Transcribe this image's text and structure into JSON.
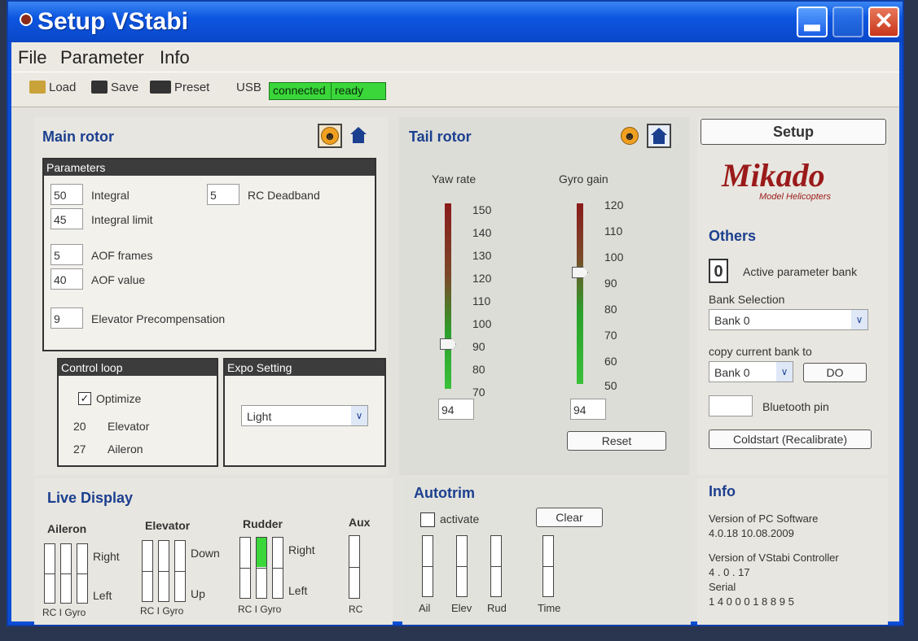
{
  "window": {
    "title": "Setup VStabi",
    "min_label": "▂",
    "close_label": "✕"
  },
  "menu": [
    "File",
    "Parameter",
    "Info"
  ],
  "toolbar": {
    "load": "Load",
    "save": "Save",
    "preset": "Preset",
    "usb": "USB",
    "status1": "connected",
    "status2": "ready"
  },
  "main_rotor": {
    "title": "Main rotor",
    "params_title": "Parameters",
    "integral": {
      "value": "50",
      "label": "Integral"
    },
    "integral_limit": {
      "value": "45",
      "label": "Integral limit"
    },
    "rc_deadband": {
      "value": "5",
      "label": "RC Deadband"
    },
    "aof_frames": {
      "value": "5",
      "label": "AOF frames"
    },
    "aof_value": {
      "value": "40",
      "label": "AOF value"
    },
    "elev_precomp": {
      "value": "9",
      "label": "Elevator Precompensation"
    },
    "control_loop": {
      "title": "Control loop",
      "optimize": "Optimize",
      "elevator_val": "20",
      "elevator": "Elevator",
      "aileron_val": "27",
      "aileron": "Aileron"
    },
    "expo": {
      "title": "Expo Setting",
      "value": "Light"
    }
  },
  "tail_rotor": {
    "title": "Tail rotor",
    "yaw_label": "Yaw rate",
    "gain_label": "Gyro gain",
    "yaw_ticks": [
      "150",
      "140",
      "130",
      "120",
      "110",
      "100",
      "90",
      "80",
      "70"
    ],
    "gain_ticks": [
      "120",
      "110",
      "100",
      "90",
      "80",
      "70",
      "60",
      "50"
    ],
    "yaw_value": "94",
    "gain_value": "94",
    "reset": "Reset"
  },
  "right": {
    "setup": "Setup",
    "logo": "Mikado",
    "logo_sub": "Model Helicopters",
    "others_title": "Others",
    "active_bank": "0",
    "active_bank_label": "Active parameter bank",
    "bank_sel_label": "Bank Selection",
    "bank_sel_value": "Bank 0",
    "copy_label": "copy current bank to",
    "copy_value": "Bank 0",
    "do": "DO",
    "bt_label": "Bluetooth pin",
    "coldstart": "Coldstart (Recalibrate)",
    "info_title": "Info",
    "pc_ver_label": "Version of PC Software",
    "pc_ver": "4.0.18 10.08.2009",
    "ctrl_ver_label": "Version of VStabi Controller",
    "ctrl_ver": "4 . 0 . 17",
    "serial_label": "Serial",
    "serial": "1 4 0 0 0 1 8 8 9 5"
  },
  "live": {
    "title": "Live Display",
    "aileron": "Aileron",
    "elevator": "Elevator",
    "rudder": "Rudder",
    "aux": "Aux",
    "right": "Right",
    "left": "Left",
    "down": "Down",
    "up": "Up",
    "rc_i_gyro": "RC  I  Gyro",
    "rc": "RC"
  },
  "autotrim": {
    "title": "Autotrim",
    "activate": "activate",
    "clear": "Clear",
    "ail": "Ail",
    "elev": "Elev",
    "rud": "Rud",
    "time": "Time"
  }
}
